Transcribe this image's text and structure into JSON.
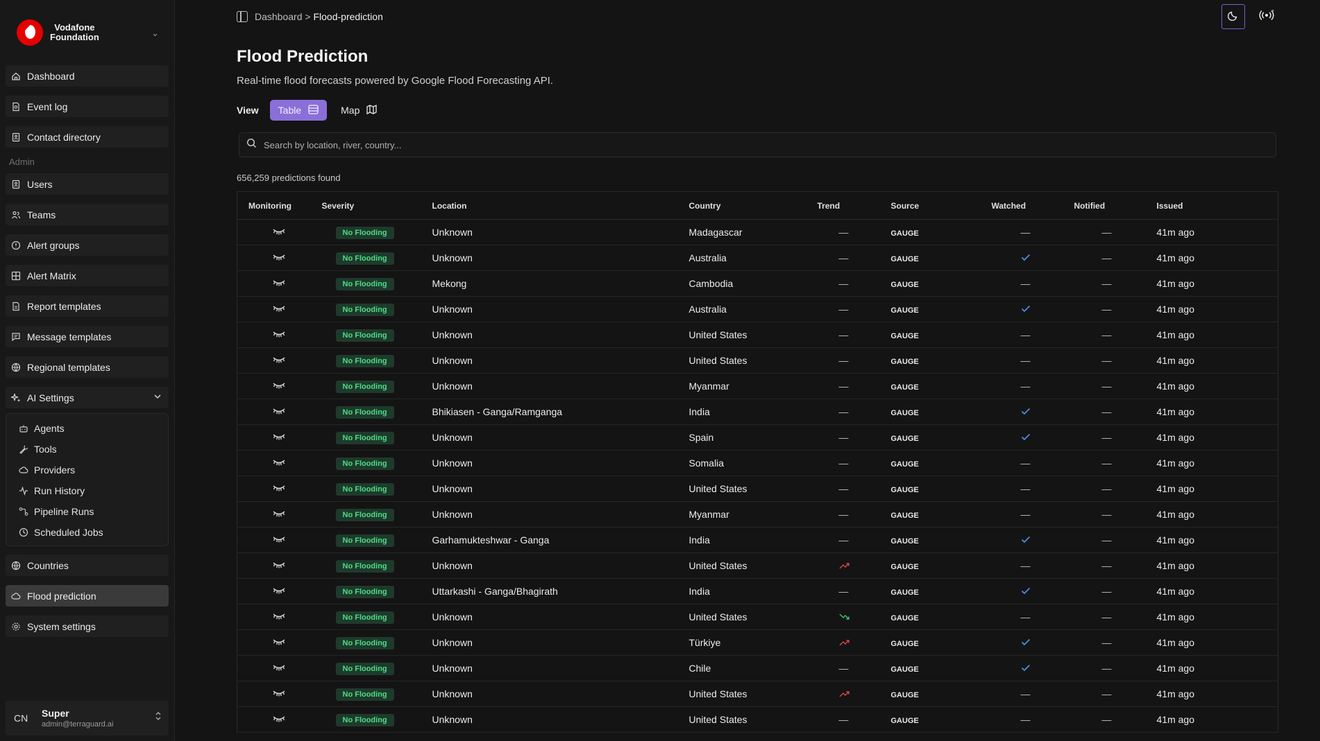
{
  "brand": {
    "name_line1": "Vodafone",
    "name_line2": "Foundation"
  },
  "sidebar": {
    "items": [
      {
        "label": "Dashboard",
        "icon": "home-icon"
      },
      {
        "label": "Event log",
        "icon": "file-search-icon"
      },
      {
        "label": "Contact directory",
        "icon": "contact-book-icon"
      }
    ],
    "admin_label": "Admin",
    "admin_items": [
      {
        "label": "Users",
        "icon": "user-icon"
      },
      {
        "label": "Teams",
        "icon": "team-icon"
      },
      {
        "label": "Alert groups",
        "icon": "alert-group-icon"
      },
      {
        "label": "Alert Matrix",
        "icon": "grid-icon"
      },
      {
        "label": "Report templates",
        "icon": "report-icon"
      },
      {
        "label": "Message templates",
        "icon": "message-icon"
      },
      {
        "label": "Regional templates",
        "icon": "globe-icon"
      }
    ],
    "ai_settings": {
      "label": "AI Settings",
      "children": [
        {
          "label": "Agents",
          "icon": "bot-icon"
        },
        {
          "label": "Tools",
          "icon": "wrench-icon"
        },
        {
          "label": "Providers",
          "icon": "cloud-icon"
        },
        {
          "label": "Run History",
          "icon": "activity-icon"
        },
        {
          "label": "Pipeline Runs",
          "icon": "pipeline-icon"
        },
        {
          "label": "Scheduled Jobs",
          "icon": "clock-icon"
        }
      ]
    },
    "bottom_items": [
      {
        "label": "Countries",
        "icon": "globe-icon",
        "active": false
      },
      {
        "label": "Flood prediction",
        "icon": "cloud-icon",
        "active": true
      },
      {
        "label": "System settings",
        "icon": "gear-icon",
        "active": false
      }
    ],
    "user": {
      "initials": "CN",
      "name": "Super",
      "email": "admin@terraguard.ai"
    }
  },
  "breadcrumb": {
    "root": "Dashboard",
    "separator": ">",
    "current": "Flood-prediction"
  },
  "page": {
    "title": "Flood Prediction",
    "subtitle": "Real-time flood forecasts powered by Google Flood Forecasting API.",
    "view_label": "View",
    "view_table": "Table",
    "view_map": "Map",
    "search_placeholder": "Search by location, river, country...",
    "count_text": "656,259 predictions found"
  },
  "table": {
    "headers": [
      "Monitoring",
      "Severity",
      "Location",
      "Country",
      "Trend",
      "Source",
      "Watched",
      "Notified",
      "Issued"
    ],
    "rows": [
      {
        "severity": "No Flooding",
        "location": "Unknown",
        "country": "Madagascar",
        "trend": "—",
        "source": "GAUGE",
        "watched": false,
        "notified": "—",
        "issued": "41m ago"
      },
      {
        "severity": "No Flooding",
        "location": "Unknown",
        "country": "Australia",
        "trend": "—",
        "source": "GAUGE",
        "watched": true,
        "notified": "—",
        "issued": "41m ago"
      },
      {
        "severity": "No Flooding",
        "location": "Mekong",
        "country": "Cambodia",
        "trend": "—",
        "source": "GAUGE",
        "watched": false,
        "notified": "—",
        "issued": "41m ago"
      },
      {
        "severity": "No Flooding",
        "location": "Unknown",
        "country": "Australia",
        "trend": "—",
        "source": "GAUGE",
        "watched": true,
        "notified": "—",
        "issued": "41m ago"
      },
      {
        "severity": "No Flooding",
        "location": "Unknown",
        "country": "United States",
        "trend": "—",
        "source": "GAUGE",
        "watched": false,
        "notified": "—",
        "issued": "41m ago"
      },
      {
        "severity": "No Flooding",
        "location": "Unknown",
        "country": "United States",
        "trend": "—",
        "source": "GAUGE",
        "watched": false,
        "notified": "—",
        "issued": "41m ago"
      },
      {
        "severity": "No Flooding",
        "location": "Unknown",
        "country": "Myanmar",
        "trend": "—",
        "source": "GAUGE",
        "watched": false,
        "notified": "—",
        "issued": "41m ago"
      },
      {
        "severity": "No Flooding",
        "location": "Bhikiasen - Ganga/Ramganga",
        "country": "India",
        "trend": "—",
        "source": "GAUGE",
        "watched": true,
        "notified": "—",
        "issued": "41m ago"
      },
      {
        "severity": "No Flooding",
        "location": "Unknown",
        "country": "Spain",
        "trend": "—",
        "source": "GAUGE",
        "watched": true,
        "notified": "—",
        "issued": "41m ago"
      },
      {
        "severity": "No Flooding",
        "location": "Unknown",
        "country": "Somalia",
        "trend": "—",
        "source": "GAUGE",
        "watched": false,
        "notified": "—",
        "issued": "41m ago"
      },
      {
        "severity": "No Flooding",
        "location": "Unknown",
        "country": "United States",
        "trend": "—",
        "source": "GAUGE",
        "watched": false,
        "notified": "—",
        "issued": "41m ago"
      },
      {
        "severity": "No Flooding",
        "location": "Unknown",
        "country": "Myanmar",
        "trend": "—",
        "source": "GAUGE",
        "watched": false,
        "notified": "—",
        "issued": "41m ago"
      },
      {
        "severity": "No Flooding",
        "location": "Garhamukteshwar - Ganga",
        "country": "India",
        "trend": "—",
        "source": "GAUGE",
        "watched": true,
        "notified": "—",
        "issued": "41m ago"
      },
      {
        "severity": "No Flooding",
        "location": "Unknown",
        "country": "United States",
        "trend": "up",
        "source": "GAUGE",
        "watched": false,
        "notified": "—",
        "issued": "41m ago"
      },
      {
        "severity": "No Flooding",
        "location": "Uttarkashi - Ganga/Bhagirath",
        "country": "India",
        "trend": "—",
        "source": "GAUGE",
        "watched": true,
        "notified": "—",
        "issued": "41m ago"
      },
      {
        "severity": "No Flooding",
        "location": "Unknown",
        "country": "United States",
        "trend": "down",
        "source": "GAUGE",
        "watched": false,
        "notified": "—",
        "issued": "41m ago"
      },
      {
        "severity": "No Flooding",
        "location": "Unknown",
        "country": "Türkiye",
        "trend": "up",
        "source": "GAUGE",
        "watched": true,
        "notified": "—",
        "issued": "41m ago"
      },
      {
        "severity": "No Flooding",
        "location": "Unknown",
        "country": "Chile",
        "trend": "—",
        "source": "GAUGE",
        "watched": true,
        "notified": "—",
        "issued": "41m ago"
      },
      {
        "severity": "No Flooding",
        "location": "Unknown",
        "country": "United States",
        "trend": "up",
        "source": "GAUGE",
        "watched": false,
        "notified": "—",
        "issued": "41m ago"
      },
      {
        "severity": "No Flooding",
        "location": "Unknown",
        "country": "United States",
        "trend": "—",
        "source": "GAUGE",
        "watched": false,
        "notified": "—",
        "issued": "41m ago"
      }
    ]
  },
  "colors": {
    "accent": "#8b6fd8",
    "badge_bg": "#1e3a2c",
    "badge_text": "#4ddc85",
    "check": "#4a8be8",
    "trend_up": "#e04545",
    "trend_down": "#3fc46a"
  }
}
